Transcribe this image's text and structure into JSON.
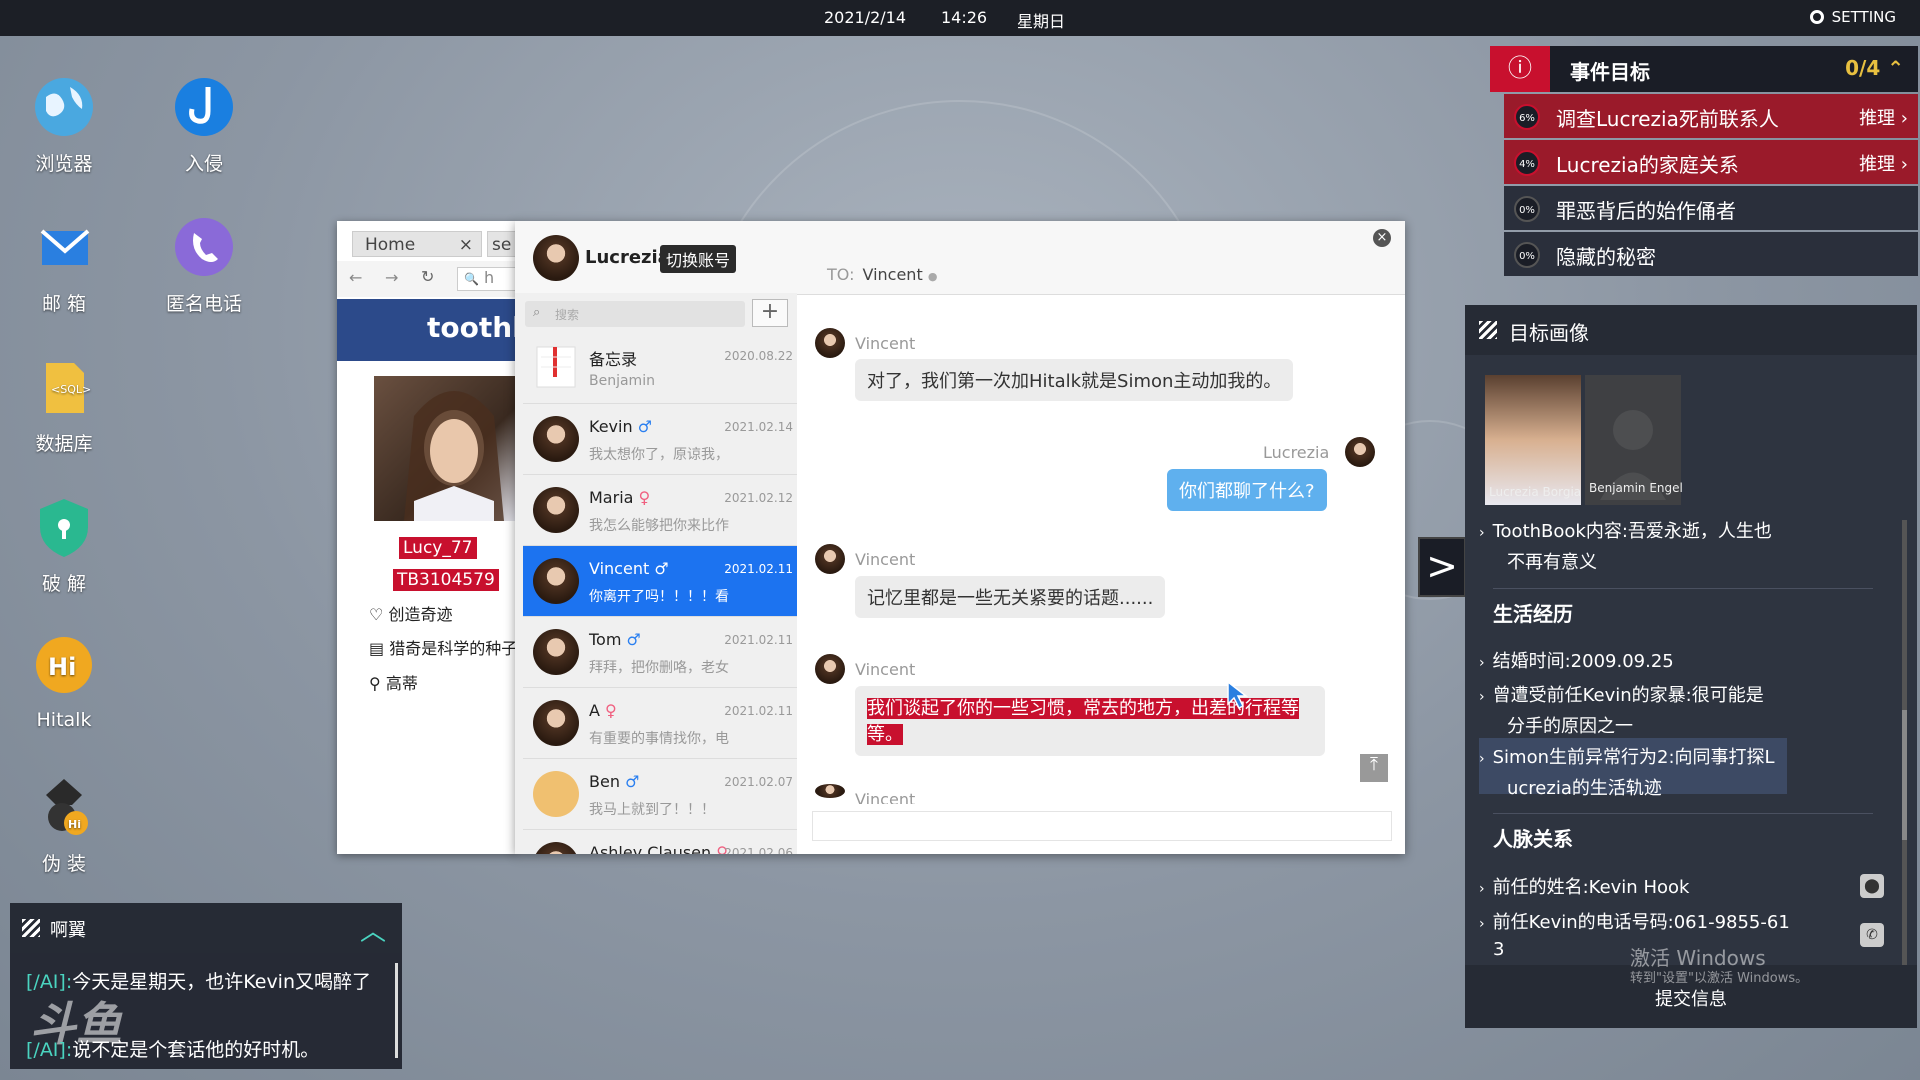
{
  "topbar": {
    "date": "2021/2/14",
    "time": "14:26",
    "weekday": "星期日",
    "setting": "SETTING"
  },
  "desktop": [
    {
      "label": "浏览器",
      "icon": "globe-icon"
    },
    {
      "label": "入侵",
      "icon": "hook-icon"
    },
    {
      "label": "邮 箱",
      "icon": "mail-icon"
    },
    {
      "label": "匿名电话",
      "icon": "phone-icon"
    },
    {
      "label": "数据库",
      "icon": "sql-icon"
    },
    {
      "label": "破 解",
      "icon": "shield-icon"
    },
    {
      "label": "Hitalk",
      "icon": "hitalk-icon"
    },
    {
      "label": "伪 装",
      "icon": "disguise-icon"
    }
  ],
  "browser": {
    "tab": "Home",
    "tab2": "se",
    "url_prefix": "h",
    "banner": "toothb",
    "username": "Lucy_77",
    "id": "TB3104579",
    "info": [
      "创造奇迹",
      "猎奇是科学的种子",
      "高蒂"
    ]
  },
  "chat": {
    "account": "Lucrezia",
    "switch_label": "切换账号",
    "search_placeholder": "搜索",
    "plus": "+",
    "contacts": [
      {
        "name": "备忘录",
        "gender": "",
        "date": "2020.08.22",
        "preview": "Benjamin"
      },
      {
        "name": "Kevin",
        "gender": "♂",
        "date": "2021.02.14",
        "preview": "我太想你了，原谅我，"
      },
      {
        "name": "Maria",
        "gender": "♀",
        "date": "2021.02.12",
        "preview": "我怎么能够把你来比作"
      },
      {
        "name": "Vincent",
        "gender": "♂",
        "date": "2021.02.11",
        "preview": "你离开了吗！！！！看"
      },
      {
        "name": "Tom",
        "gender": "♂",
        "date": "2021.02.11",
        "preview": "拜拜，把你删咯，老女"
      },
      {
        "name": "A",
        "gender": "♀",
        "date": "2021.02.11",
        "preview": "有重要的事情找你，电"
      },
      {
        "name": "Ben",
        "gender": "♂",
        "date": "2021.02.07",
        "preview": "我马上就到了！！！"
      },
      {
        "name": "Ashley Clausen",
        "gender": "♀",
        "date": "2021.02.06",
        "preview": ""
      }
    ],
    "to_label": "TO:",
    "to_name": "Vincent",
    "messages": [
      {
        "sender": "Vincent",
        "text": "对了，我们第一次加Hitalk就是Simon主动加我的。"
      },
      {
        "sender": "Lucrezia",
        "text": "你们都聊了什么?"
      },
      {
        "sender": "Vincent",
        "text": "记忆里都是一些无关紧要的话题......"
      },
      {
        "sender": "Vincent",
        "text": "我们谈起了你的一些习惯，常去的地方，出差的行程等等。"
      },
      {
        "sender": "Vincent",
        "text": ""
      }
    ]
  },
  "goals": {
    "title": "事件目标",
    "count": "0/4",
    "items": [
      {
        "pct": "6%",
        "label": "调查Lucrezia死前联系人",
        "action": "推理"
      },
      {
        "pct": "4%",
        "label": "Lucrezia的家庭关系",
        "action": "推理"
      },
      {
        "pct": "0%",
        "label": "罪恶背后的始作俑者",
        "action": ""
      },
      {
        "pct": "0%",
        "label": "隐藏的秘密",
        "action": ""
      }
    ]
  },
  "profile": {
    "title": "目标画像",
    "person1": "Lucrezia Borgia",
    "person2": "Benjamin Engel",
    "tb1": "ToothBook内容:吾爱永逝，人生也",
    "tb2": "不再有意义",
    "life_title": "生活经历",
    "marry": "结婚时间:2009.09.25",
    "abuse1": "曾遭受前任Kevin的家暴:很可能是",
    "abuse2": "分手的原因之一",
    "simon1": "Simon生前异常行为2:向同事打探L",
    "simon2": "ucrezia的生活轨迹",
    "rel_title": "人脉关系",
    "ex_name": "前任的姓名:Kevin Hook",
    "ex_phone1": "前任Kevin的电话号码:061-9855-61",
    "ex_phone2": "3",
    "watermark1": "激活 Windows",
    "watermark2": "转到\"设置\"以激活 Windows。",
    "submit": "提交信息"
  },
  "ai": {
    "title": "啊翼",
    "lines": [
      {
        "tag": "[/AI]:",
        "text": "今天是星期天，也许Kevin又喝醉了"
      },
      {
        "tag": "[/AI]:",
        "text": "说不定是个套话他的好时机。"
      }
    ],
    "logo": "斗鱼"
  }
}
